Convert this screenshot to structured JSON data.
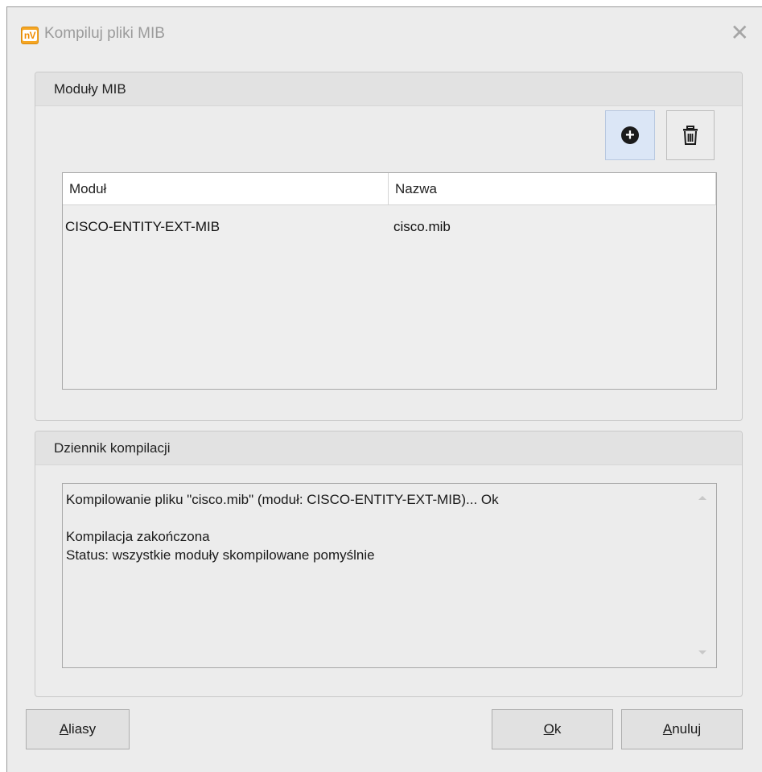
{
  "window": {
    "app_icon_text": "nV",
    "title": "Kompiluj pliki MIB",
    "close_glyph": "✕"
  },
  "modules_group": {
    "title": "Moduły MIB",
    "add_icon": "plus-circle-icon",
    "delete_icon": "trash-icon",
    "columns": [
      "Moduł",
      "Nazwa"
    ],
    "rows": [
      {
        "module": "CISCO-ENTITY-EXT-MIB",
        "name": "cisco.mib"
      }
    ]
  },
  "log_group": {
    "title": "Dziennik kompilacji",
    "lines": [
      "Kompilowanie pliku \"cisco.mib\" (moduł: CISCO-ENTITY-EXT-MIB)... Ok",
      "",
      "Kompilacja zakończona",
      "Status: wszystkie moduły skompilowane pomyślnie"
    ]
  },
  "buttons": {
    "aliasy": {
      "mnemonic": "A",
      "rest": "liasy"
    },
    "ok": {
      "mnemonic": "O",
      "rest": "k"
    },
    "anuluj": {
      "mnemonic": "A",
      "rest": "nuluj"
    }
  },
  "colors": {
    "add_button_bg": "#dbe6f6",
    "app_icon": "#f6a623",
    "window_bg": "#ececec"
  }
}
